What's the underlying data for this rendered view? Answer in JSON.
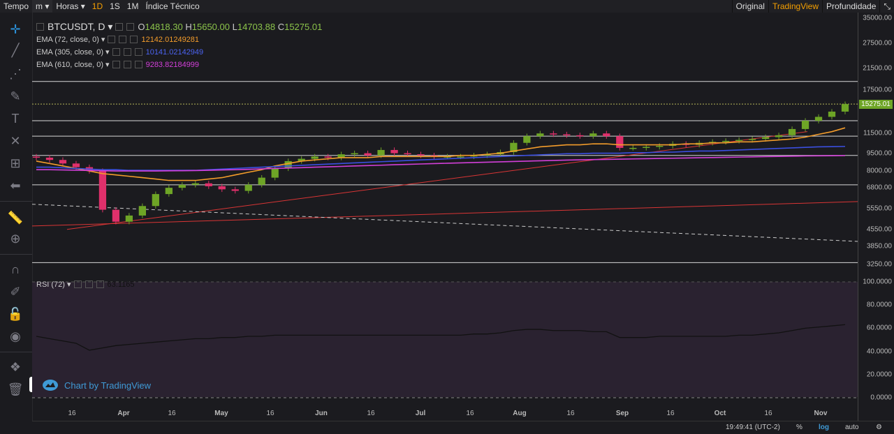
{
  "topbar": {
    "items": [
      "Tempo",
      "m",
      "Horas",
      "1D",
      "1S",
      "1M",
      "Índice Técnico"
    ],
    "active_index": 3,
    "views": [
      "Original",
      "TradingView",
      "Profundidade"
    ],
    "active_view": 1
  },
  "header": {
    "symbol": "BTCUSDT, D",
    "open_label": "O",
    "open": "14818.30",
    "high_label": "H",
    "high": "15650.00",
    "low_label": "L",
    "low": "14703.88",
    "close_label": "C",
    "close": "15275.01"
  },
  "indicators": [
    {
      "label": "EMA (72, close, 0)",
      "value": "12142.01249281",
      "color": "#f39c2b"
    },
    {
      "label": "EMA (305, close, 0)",
      "value": "10141.02142949",
      "color": "#3b4fe0"
    },
    {
      "label": "EMA (610, close, 0)",
      "value": "9283.82184999",
      "color": "#d23fd8"
    }
  ],
  "rsi": {
    "label": "RSI (72)",
    "value": "63.1165"
  },
  "price_axis": [
    "35000.00",
    "27500.00",
    "21500.00",
    "17500.00",
    "15275.01",
    "11500.00",
    "9500.00",
    "8000.00",
    "6800.00",
    "5550.00",
    "4550.00",
    "3850.00",
    "3250.00"
  ],
  "current_price": "15275.01",
  "rsi_axis": [
    "100.0000",
    "80.0000",
    "60.0000",
    "40.0000",
    "20.0000",
    "0.0000"
  ],
  "time_axis": [
    "16",
    "Apr",
    "16",
    "May",
    "16",
    "Jun",
    "16",
    "Jul",
    "16",
    "Aug",
    "16",
    "Sep",
    "16",
    "Oct",
    "16",
    "Nov"
  ],
  "watermark": "Chart by TradingView",
  "bottom": {
    "time": "19:49:41 (UTC-2)",
    "percent": "%",
    "log": "log",
    "auto": "auto"
  },
  "colors": {
    "up": "#6ea526",
    "down": "#e0306b",
    "ema72": "#f39c2b",
    "ema305": "#3b4fe0",
    "ema610": "#d23fd8",
    "trend": "#d93535",
    "accent": "#f6a000"
  },
  "chart_data": {
    "type": "line",
    "title": "BTCUSDT, D",
    "y_scale": "log",
    "series": [
      {
        "name": "BTCUSDT",
        "values": [
          9100,
          8900,
          8600,
          8300,
          8000,
          5500,
          4900,
          5200,
          5700,
          6400,
          6800,
          7000,
          7100,
          6900,
          6700,
          6600,
          7000,
          7500,
          8200,
          8800,
          9000,
          9200,
          9100,
          9400,
          9500,
          9300,
          9800,
          9500,
          9400,
          9300,
          9200,
          9200,
          9200,
          9300,
          9400,
          9600,
          10500,
          11200,
          11500,
          11400,
          11300,
          11200,
          11500,
          11200,
          10000,
          10000,
          10100,
          10200,
          10400,
          10300,
          10500,
          10600,
          10700,
          10800,
          10900,
          11100,
          11300,
          12000,
          13000,
          13500,
          14200,
          15275
        ]
      },
      {
        "name": "EMA (72, close, 0)",
        "values": [
          8800,
          8600,
          8400,
          8200,
          8000,
          7800,
          7700,
          7600,
          7500,
          7400,
          7300,
          7300,
          7300,
          7400,
          7500,
          7700,
          7900,
          8100,
          8400,
          8600,
          8800,
          8900,
          9000,
          9100,
          9100,
          9100,
          9200,
          9200,
          9200,
          9200,
          9200,
          9200,
          9300,
          9300,
          9400,
          9500,
          9700,
          9900,
          10100,
          10200,
          10300,
          10300,
          10400,
          10400,
          10300,
          10300,
          10300,
          10300,
          10300,
          10400,
          10400,
          10500,
          10500,
          10600,
          10600,
          10700,
          10800,
          10900,
          11100,
          11400,
          11700,
          12142
        ]
      },
      {
        "name": "EMA (305, close, 0)",
        "values": [
          8300,
          8300,
          8250,
          8200,
          8150,
          8100,
          8100,
          8050,
          8050,
          8050,
          8050,
          8050,
          8050,
          8100,
          8150,
          8200,
          8250,
          8300,
          8350,
          8400,
          8450,
          8500,
          8550,
          8600,
          8650,
          8700,
          8750,
          8800,
          8850,
          8900,
          8950,
          9000,
          9050,
          9100,
          9150,
          9200,
          9250,
          9300,
          9350,
          9400,
          9450,
          9450,
          9500,
          9500,
          9500,
          9550,
          9550,
          9600,
          9600,
          9650,
          9700,
          9700,
          9750,
          9800,
          9850,
          9900,
          9950,
          10000,
          10050,
          10100,
          10120,
          10141
        ]
      },
      {
        "name": "EMA (610, close, 0)",
        "values": [
          8100,
          8100,
          8080,
          8060,
          8040,
          8020,
          8000,
          8000,
          8000,
          8000,
          8010,
          8020,
          8030,
          8050,
          8080,
          8100,
          8130,
          8160,
          8200,
          8230,
          8260,
          8300,
          8330,
          8360,
          8400,
          8430,
          8460,
          8500,
          8530,
          8560,
          8590,
          8620,
          8650,
          8680,
          8710,
          8740,
          8770,
          8800,
          8830,
          8860,
          8890,
          8910,
          8930,
          8950,
          8970,
          8990,
          9010,
          9030,
          9050,
          9070,
          9090,
          9110,
          9130,
          9150,
          9170,
          9190,
          9210,
          9230,
          9250,
          9260,
          9270,
          9283
        ]
      },
      {
        "name": "RSI (72)",
        "values": [
          53,
          51,
          49,
          47,
          41,
          43,
          45,
          46,
          47,
          48,
          49,
          50,
          51,
          51,
          52,
          52,
          53,
          53,
          54,
          54,
          54,
          54,
          54,
          54,
          54,
          54,
          54,
          54,
          54,
          54,
          54,
          54,
          54,
          55,
          55,
          56,
          58,
          59,
          59,
          58,
          58,
          58,
          57,
          57,
          52,
          52,
          52,
          53,
          53,
          53,
          53,
          53,
          53,
          54,
          54,
          55,
          56,
          58,
          60,
          61,
          62,
          63.1
        ]
      }
    ]
  }
}
